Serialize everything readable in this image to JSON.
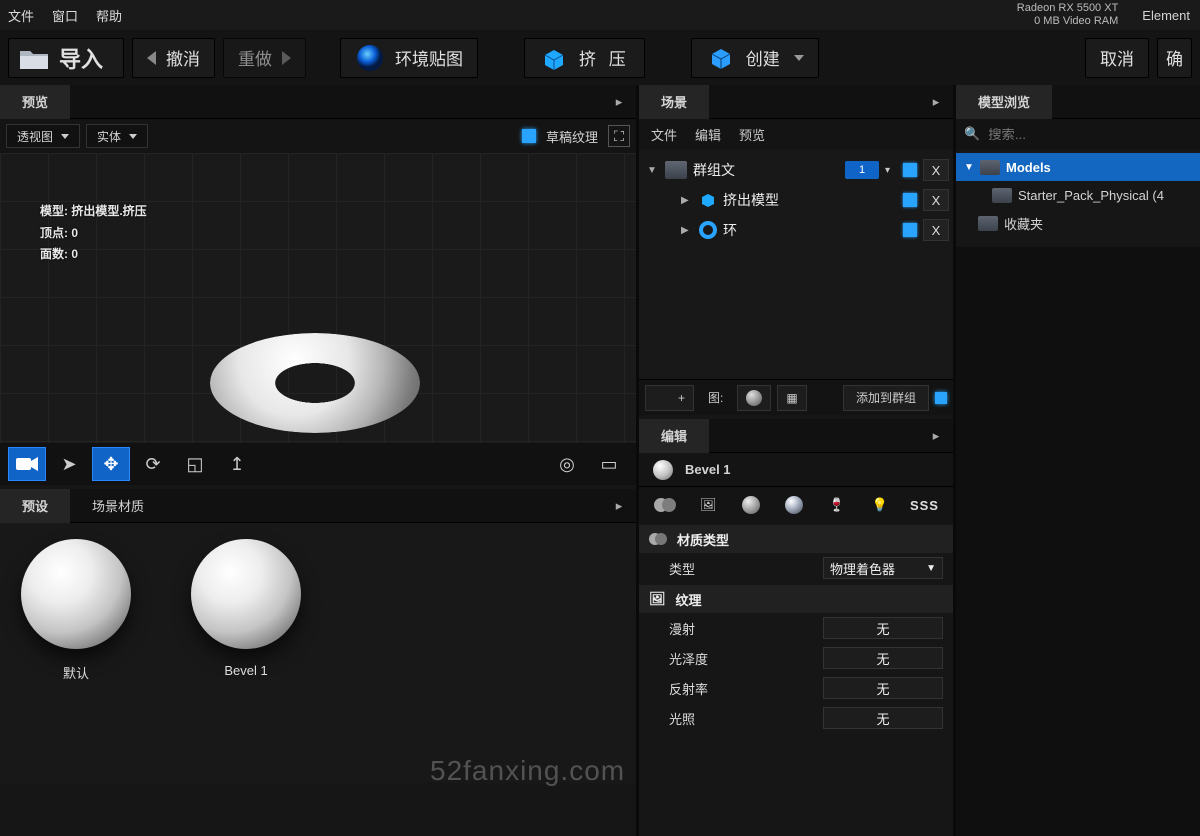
{
  "menu": {
    "file": "文件",
    "window": "窗口",
    "help": "帮助"
  },
  "gpu": {
    "name": "Radeon RX 5500 XT",
    "vram": "0 MB Video RAM",
    "element": "Element"
  },
  "toolbar": {
    "import": "导入",
    "undo": "撤消",
    "redo": "重做",
    "envmap": "环境贴图",
    "extrude": "挤 压",
    "create": "创建",
    "cancel": "取消",
    "ok": "确"
  },
  "preview": {
    "title": "预览",
    "view_dd": "透视图",
    "shade_dd": "实体",
    "draft": "草稿纹理",
    "info_model": "模型: 挤出模型.挤压",
    "info_verts": "顶点:  0",
    "info_faces": "面数:  0"
  },
  "materials": {
    "tab_presets": "预设",
    "tab_scene": "场景材质",
    "items": [
      {
        "name": "默认"
      },
      {
        "name": "Bevel 1"
      }
    ]
  },
  "scene": {
    "title": "场景",
    "menu_file": "文件",
    "menu_edit": "编辑",
    "menu_preview": "预览",
    "group": "群组文",
    "group_count": "1",
    "items": [
      {
        "name": "挤出模型"
      },
      {
        "name": "环"
      }
    ],
    "footer_img": "图:",
    "footer_add": "添加到群组"
  },
  "editor": {
    "title": "编辑",
    "material": "Bevel 1",
    "sect_mattype": "材质类型",
    "type_label": "类型",
    "type_value": "物理着色器",
    "sect_texture": "纹理",
    "fields": [
      {
        "label": "漫射",
        "value": "无"
      },
      {
        "label": "光泽度",
        "value": "无"
      },
      {
        "label": "反射率",
        "value": "无"
      },
      {
        "label": "光照",
        "value": "无"
      }
    ],
    "cats_sss": "SSS"
  },
  "browser": {
    "title": "模型浏览",
    "search_ph": "搜索...",
    "models": "Models",
    "starter": "Starter_Pack_Physical (4",
    "favorites": "收藏夹"
  },
  "watermark": "52fanxing.com"
}
